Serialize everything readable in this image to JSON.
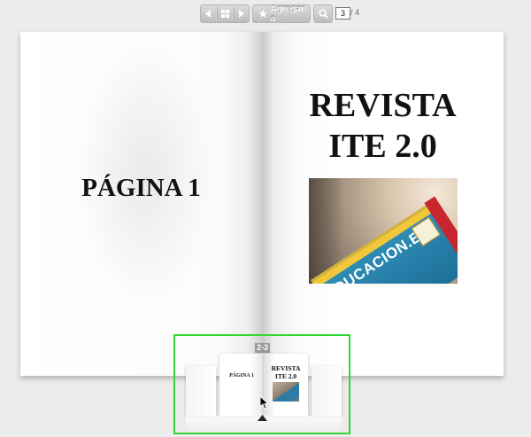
{
  "toolbar": {
    "prev_icon": "chevron-left-icon",
    "grid_icon": "grid-icon",
    "next_icon": "chevron-right-icon",
    "favorite_icon": "star-icon",
    "favorite_label": "Agregar a",
    "search_icon": "search-icon",
    "current_page": "3",
    "total_pages": "/ 4"
  },
  "book": {
    "left_page": {
      "title": "PÁGINA 1"
    },
    "right_page": {
      "title_line1": "REVISTA",
      "title_line2": "ITE 2.0",
      "photo_text": "EDUCACION.ES"
    }
  },
  "thumbnails": {
    "indicator": "2-3",
    "left_label": "PÁGINA 1",
    "right_title_line1": "REVISTA",
    "right_title_line2": "ITE 2.0"
  },
  "colors": {
    "background": "#ececec",
    "toolbar": "#c8c8c8",
    "highlight": "#33d633",
    "card_blue": "#2f8fb8",
    "card_yellow": "#f3c73a",
    "card_red": "#c7262f"
  }
}
